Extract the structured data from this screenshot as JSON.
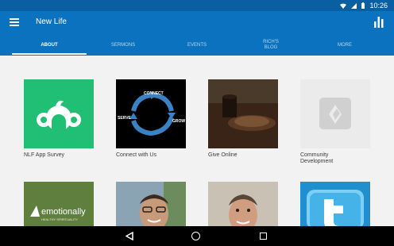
{
  "status": {
    "time": "10:26"
  },
  "app": {
    "title": "New Life"
  },
  "tabs": [
    {
      "label": "ABOUT",
      "active": true
    },
    {
      "label": "SERMONS",
      "active": false
    },
    {
      "label": "EVENTS",
      "active": false
    },
    {
      "label": "RICH'S\nBLOG",
      "active": false
    },
    {
      "label": "MORE",
      "active": false
    }
  ],
  "tiles": [
    {
      "label": "NLF App Survey",
      "icon": "surveymonkey-logo",
      "bg": "#21bf73"
    },
    {
      "label": "Connect with Us",
      "icon": "connect-cycle-graphic",
      "bg": "#000000",
      "cycle": [
        "CONNECT",
        "GROW",
        "SERVE"
      ]
    },
    {
      "label": "Give Online",
      "icon": "coffee-cup-photo",
      "bg": "#2a1a12"
    },
    {
      "label": "Community\nDevelopment",
      "icon": "placeholder-logo",
      "bg": "#ebebeb"
    },
    {
      "label": "",
      "icon": "emotionally-healthy-logo",
      "bg": "#5f7f3f",
      "text": "emotionally",
      "subtext": "HEALTHY SPIRITUALITY"
    },
    {
      "label": "",
      "icon": "person-photo",
      "bg": "#6a8aa0"
    },
    {
      "label": "",
      "icon": "person-photo",
      "bg": "#b9b0a3"
    },
    {
      "label": "",
      "icon": "twitter-logo",
      "bg": "#1f8fd0"
    }
  ],
  "colors": {
    "status_bar": "#0a5fa3",
    "app_bar": "#0a72bf",
    "tab_inactive": "#b9d7ee",
    "background": "#f2f2f2"
  }
}
